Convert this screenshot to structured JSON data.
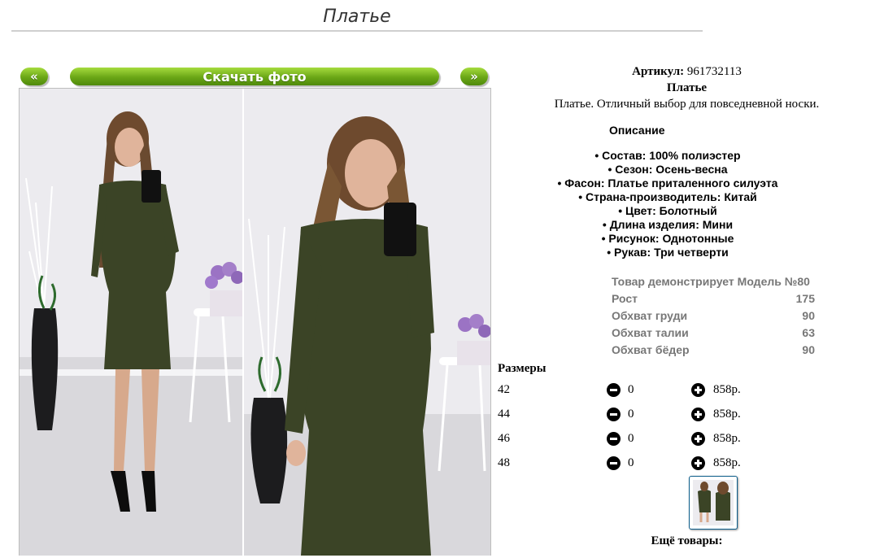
{
  "page": {
    "title": "Платье"
  },
  "gallery": {
    "prev_label": "«",
    "download_label": "Скачать фото",
    "next_label": "»"
  },
  "product": {
    "article_label": "Артикул:",
    "article_value": "961732113",
    "name": "Платье",
    "short_description": "Платье. Отличный выбор для повседневной носки.",
    "description_heading": "Описание",
    "features": [
      "• Состав: 100% полиэстер",
      "• Сезон: Осень-весна",
      "• Фасон: Платье приталенного силуэта",
      "• Страна-производитель: Китай",
      "• Цвет: Болотный",
      "• Длина изделия: Мини",
      "• Рисунок: Однотонные",
      "• Рукав: Три четверти"
    ],
    "dress_color": "#3b4426"
  },
  "model": {
    "heading": "Товар демонстрирует Модель №80",
    "rows": [
      {
        "label": "Рост",
        "value": "175"
      },
      {
        "label": "Обхват груди",
        "value": "90"
      },
      {
        "label": "Обхват талии",
        "value": "63"
      },
      {
        "label": "Обхват бёдер",
        "value": "90"
      }
    ]
  },
  "sizes": {
    "heading": "Размеры",
    "rows": [
      {
        "size": "42",
        "qty": "0",
        "price": "858р."
      },
      {
        "size": "44",
        "qty": "0",
        "price": "858р."
      },
      {
        "size": "46",
        "qty": "0",
        "price": "858р."
      },
      {
        "size": "48",
        "qty": "0",
        "price": "858р."
      }
    ],
    "minus_icon": "minus-circle-icon",
    "plus_icon": "plus-circle-icon"
  },
  "more": {
    "heading": "Ещё товары:"
  },
  "colors": {
    "accent_green": "#6aa616",
    "link_green": "#2a7a00",
    "muted_text": "#777777"
  }
}
